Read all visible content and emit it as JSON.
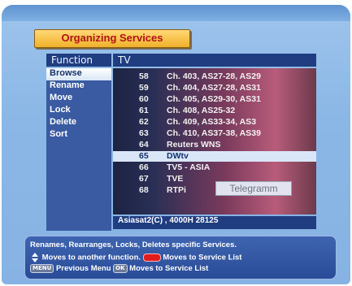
{
  "title": "Organizing Services",
  "function_panel": {
    "header": "Function",
    "items": [
      "Browse",
      "Rename",
      "Move",
      "Lock",
      "Delete",
      "Sort"
    ],
    "selected": "Browse"
  },
  "service_panel": {
    "header": "TV",
    "services": [
      {
        "num": "58",
        "name": "Ch. 403, AS27-28, AS29"
      },
      {
        "num": "59",
        "name": "Ch. 404, AS27-28, AS31"
      },
      {
        "num": "60",
        "name": "Ch. 405, AS29-30, AS31"
      },
      {
        "num": "61",
        "name": "Ch. 408, AS25-32"
      },
      {
        "num": "62",
        "name": "Ch. 409,  AS33-34, AS3"
      },
      {
        "num": "63",
        "name": "Ch. 410, AS37-38, AS39"
      },
      {
        "num": "64",
        "name": "Reuters WNS"
      },
      {
        "num": "65",
        "name": "DWtv"
      },
      {
        "num": "66",
        "name": "TV5 - ASIA"
      },
      {
        "num": "67",
        "name": "TVE"
      },
      {
        "num": "68",
        "name": "RTPi"
      }
    ],
    "selected": "65",
    "preview_overlay": "Telegramm",
    "satellite_info": "Asiasat2(C) , 4000H 28125"
  },
  "help": {
    "description": "Renames, Rearranges, Locks, Deletes specific Services.",
    "line2_a": "Moves to another function.",
    "line2_b": "Moves to Service List",
    "line3_a": "Previous Menu",
    "line3_b": "Moves to Service List",
    "key_menu": "MENU",
    "key_ok": "OK",
    "key_red_color": "#e01c1c"
  },
  "colors": {
    "panel_header": "#1f3d80",
    "title_text": "#b01414",
    "title_bg": "#f0b12a",
    "selection": "#d9e6f8"
  }
}
